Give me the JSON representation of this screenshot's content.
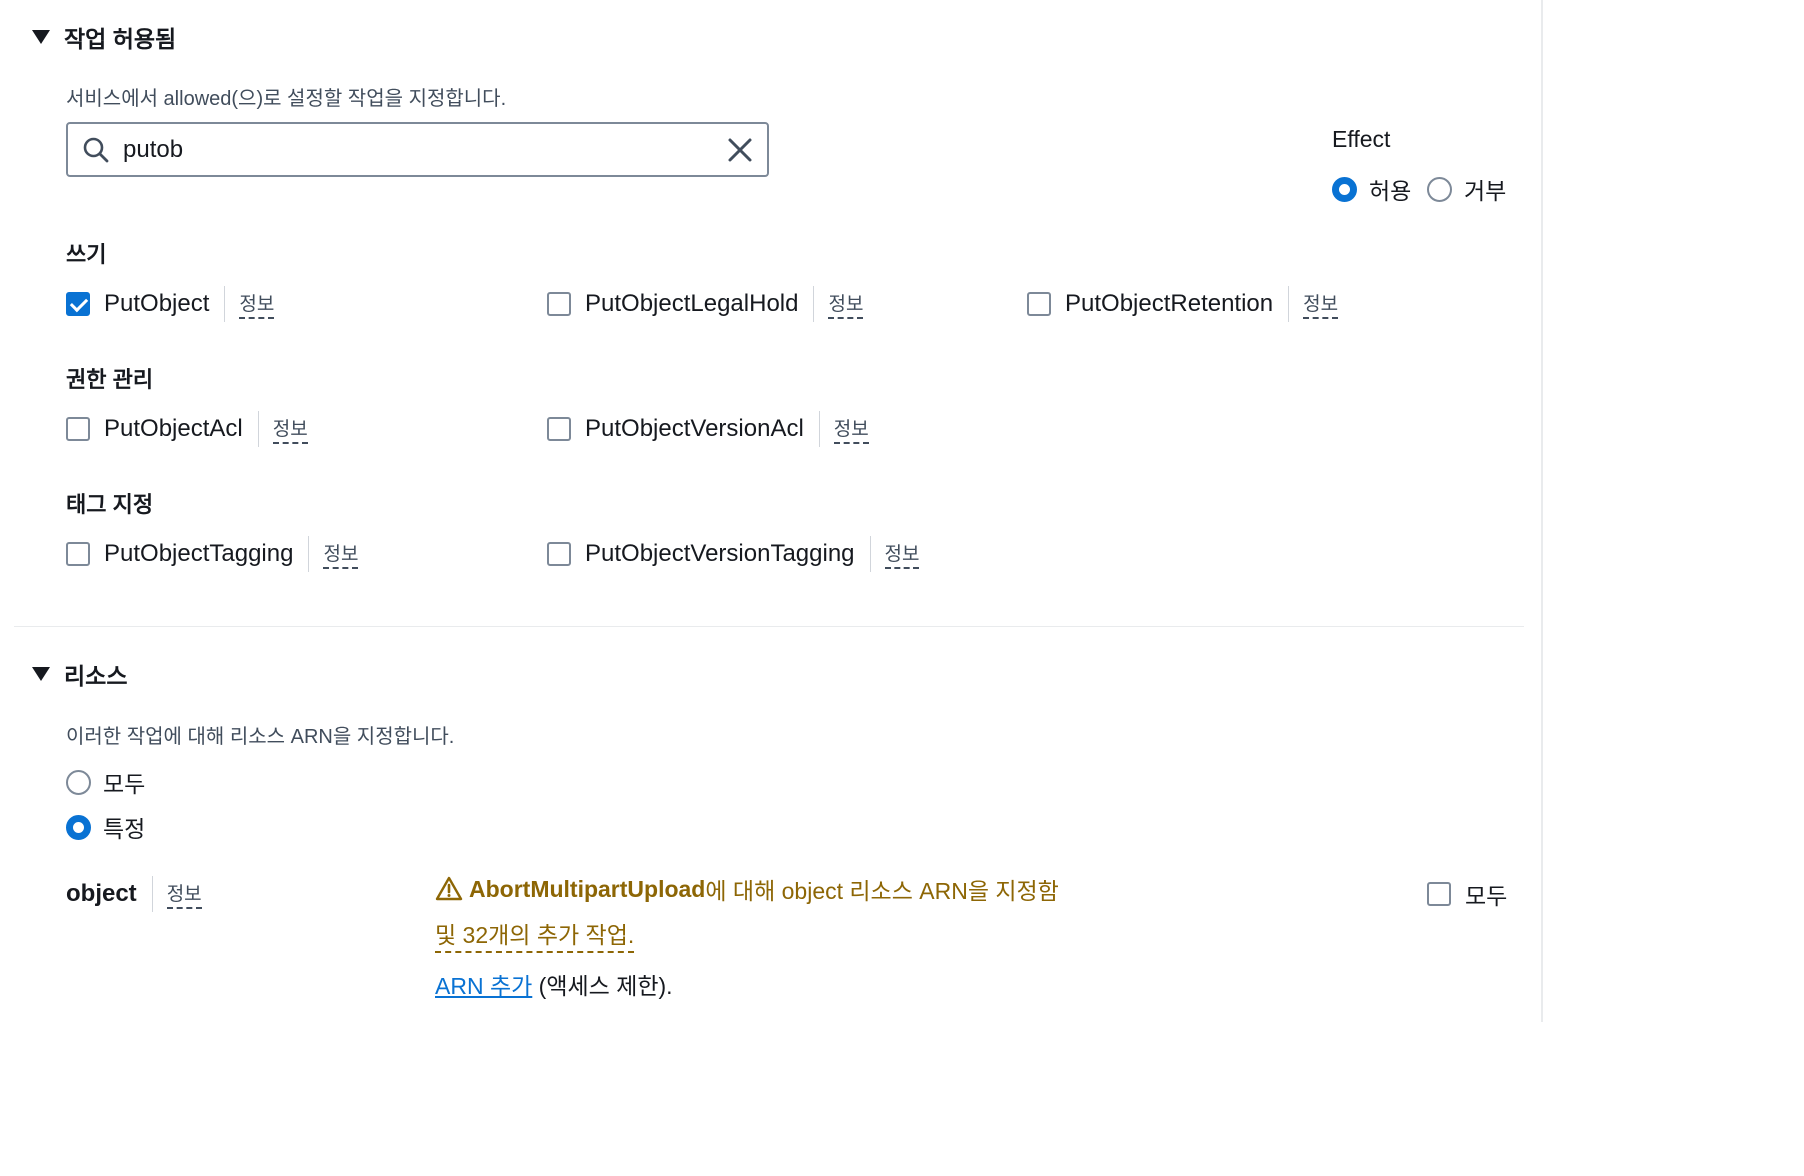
{
  "actions_section": {
    "title": "작업 허용됨",
    "description": "서비스에서 allowed(으)로 설정할 작업을 지정합니다.",
    "search": {
      "value": "putob",
      "placeholder": ""
    },
    "effect": {
      "label": "Effect",
      "options": [
        {
          "label": "허용",
          "checked": true
        },
        {
          "label": "거부",
          "checked": false
        }
      ]
    },
    "groups": [
      {
        "title": "쓰기",
        "items": [
          {
            "label": "PutObject",
            "checked": true,
            "info": "정보"
          },
          {
            "label": "PutObjectLegalHold",
            "checked": false,
            "info": "정보"
          },
          {
            "label": "PutObjectRetention",
            "checked": false,
            "info": "정보"
          }
        ]
      },
      {
        "title": "권한 관리",
        "items": [
          {
            "label": "PutObjectAcl",
            "checked": false,
            "info": "정보"
          },
          {
            "label": "PutObjectVersionAcl",
            "checked": false,
            "info": "정보"
          }
        ]
      },
      {
        "title": "태그 지정",
        "items": [
          {
            "label": "PutObjectTagging",
            "checked": false,
            "info": "정보"
          },
          {
            "label": "PutObjectVersionTagging",
            "checked": false,
            "info": "정보"
          }
        ]
      }
    ]
  },
  "resources_section": {
    "title": "리소스",
    "description": "이러한 작업에 대해 리소스 ARN을 지정합니다.",
    "options": [
      {
        "label": "모두",
        "checked": false
      },
      {
        "label": "특정",
        "checked": true
      }
    ],
    "object": {
      "label": "object",
      "info": "정보",
      "warning_bold": "AbortMultipartUpload",
      "warning_text": "에 대해 object 리소스 ARN을 지정함",
      "warning_more": "및 32개의 추가 작업.",
      "add_arn_link": "ARN 추가",
      "add_arn_suffix": " (액세스 제한).",
      "all_label": "모두",
      "all_checked": false
    }
  },
  "colors": {
    "accent": "#0972d3",
    "warning": "#8d6605",
    "text": "#16191f",
    "secondary_text": "#414d5c"
  }
}
